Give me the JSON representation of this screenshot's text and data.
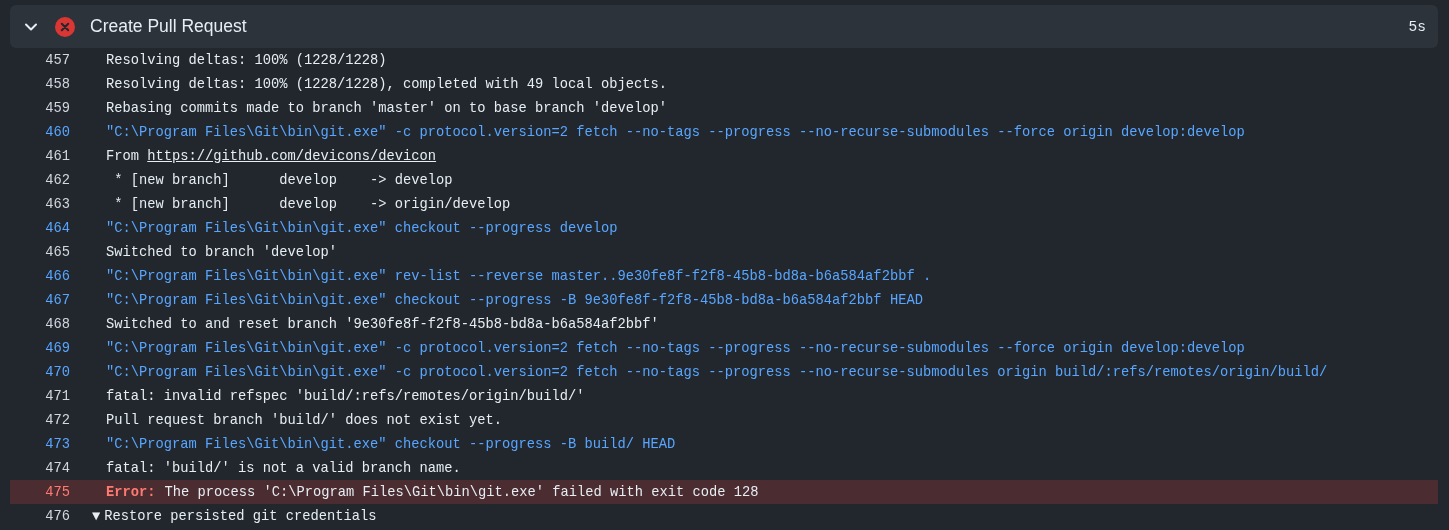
{
  "step": {
    "title": "Create Pull Request",
    "failed": true,
    "expanded": true,
    "duration": "5s"
  },
  "log": [
    {
      "number": "457",
      "kind": "output",
      "text": "Resolving deltas: 100% (1228/1228)"
    },
    {
      "number": "458",
      "kind": "output",
      "text": "Resolving deltas: 100% (1228/1228), completed with 49 local objects."
    },
    {
      "number": "459",
      "kind": "output",
      "text": "Rebasing commits made to branch 'master' on to base branch 'develop'"
    },
    {
      "number": "460",
      "kind": "command",
      "text": "\"C:\\Program Files\\Git\\bin\\git.exe\" -c protocol.version=2 fetch --no-tags --progress --no-recurse-submodules --force origin develop:develop"
    },
    {
      "number": "461",
      "kind": "link",
      "text": "From ",
      "link": "https://github.com/devicons/devicon"
    },
    {
      "number": "462",
      "kind": "output",
      "text": " * [new branch]      develop    -> develop"
    },
    {
      "number": "463",
      "kind": "output",
      "text": " * [new branch]      develop    -> origin/develop"
    },
    {
      "number": "464",
      "kind": "command",
      "text": "\"C:\\Program Files\\Git\\bin\\git.exe\" checkout --progress develop"
    },
    {
      "number": "465",
      "kind": "output",
      "text": "Switched to branch 'develop'"
    },
    {
      "number": "466",
      "kind": "command",
      "text": "\"C:\\Program Files\\Git\\bin\\git.exe\" rev-list --reverse master..9e30fe8f-f2f8-45b8-bd8a-b6a584af2bbf ."
    },
    {
      "number": "467",
      "kind": "command",
      "text": "\"C:\\Program Files\\Git\\bin\\git.exe\" checkout --progress -B 9e30fe8f-f2f8-45b8-bd8a-b6a584af2bbf HEAD"
    },
    {
      "number": "468",
      "kind": "output",
      "text": "Switched to and reset branch '9e30fe8f-f2f8-45b8-bd8a-b6a584af2bbf'"
    },
    {
      "number": "469",
      "kind": "command",
      "text": "\"C:\\Program Files\\Git\\bin\\git.exe\" -c protocol.version=2 fetch --no-tags --progress --no-recurse-submodules --force origin develop:develop"
    },
    {
      "number": "470",
      "kind": "command",
      "text": "\"C:\\Program Files\\Git\\bin\\git.exe\" -c protocol.version=2 fetch --no-tags --progress --no-recurse-submodules origin build/:refs/remotes/origin/build/"
    },
    {
      "number": "471",
      "kind": "output",
      "text": "fatal: invalid refspec 'build/:refs/remotes/origin/build/'"
    },
    {
      "number": "472",
      "kind": "output",
      "text": "Pull request branch 'build/' does not exist yet."
    },
    {
      "number": "473",
      "kind": "command",
      "text": "\"C:\\Program Files\\Git\\bin\\git.exe\" checkout --progress -B build/ HEAD"
    },
    {
      "number": "474",
      "kind": "output",
      "text": "fatal: 'build/' is not a valid branch name."
    },
    {
      "number": "475",
      "kind": "error",
      "label": "Error:",
      "text": "The process 'C:\\Program Files\\Git\\bin\\git.exe' failed with exit code 128"
    },
    {
      "number": "476",
      "kind": "group",
      "toggle": "▼",
      "text": "Restore persisted git credentials"
    }
  ]
}
